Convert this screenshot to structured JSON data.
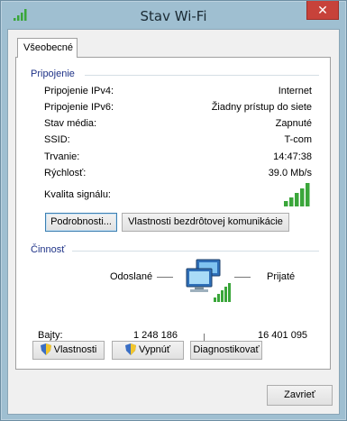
{
  "window": {
    "title": "Stav Wi-Fi",
    "close_glyph": "✕",
    "icon": "wifi-signal-icon"
  },
  "tab": {
    "label": "Všeobecné"
  },
  "connection": {
    "header": "Pripojenie",
    "rows": [
      {
        "label": "Pripojenie IPv4:",
        "value": "Internet"
      },
      {
        "label": "Pripojenie IPv6:",
        "value": "Žiadny prístup do siete"
      },
      {
        "label": "Stav média:",
        "value": "Zapnuté"
      },
      {
        "label": "SSID:",
        "value": "T-com"
      },
      {
        "label": "Trvanie:",
        "value": "14:47:38"
      },
      {
        "label": "Rýchlosť:",
        "value": "39.0 Mb/s"
      }
    ],
    "signal_label": "Kvalita signálu:",
    "signal_bars": 5,
    "details_button": "Podrobnosti...",
    "wireless_props_button": "Vlastnosti bezdrôtovej komunikácie"
  },
  "activity": {
    "header": "Činnosť",
    "sent_label": "Odoslané",
    "received_label": "Prijaté",
    "bytes_label": "Bajty:",
    "bytes_sent": "1 248 186",
    "bytes_received": "16 401 095"
  },
  "buttons": {
    "properties": "Vlastnosti",
    "disable": "Vypnúť",
    "diagnose": "Diagnostikovať",
    "close": "Zavrieť"
  },
  "colors": {
    "group_header": "#1e3287",
    "signal_green": "#3aa63a",
    "close_red": "#c7423a"
  }
}
